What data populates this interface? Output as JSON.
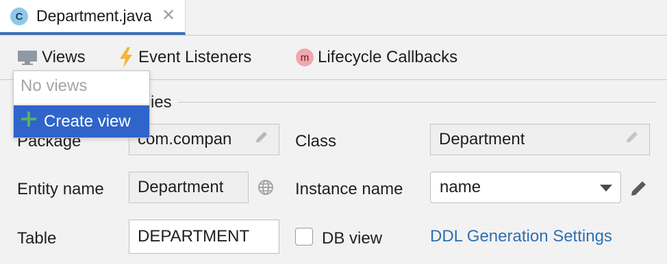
{
  "tab": {
    "icon_letter": "C",
    "title": "Department.java",
    "close_glyph": "✕"
  },
  "toolbar": {
    "views_label": "Views",
    "event_listeners_label": "Event Listeners",
    "lifecycle_icon_letter": "m",
    "lifecycle_callbacks_label": "Lifecycle Callbacks"
  },
  "section": {
    "title_visible_fragment": "ies"
  },
  "views_popup": {
    "empty_text": "No views",
    "create_label": "Create view",
    "create_icon": "+"
  },
  "form": {
    "package_label": "Package",
    "package_value": "com.compan",
    "class_label": "Class",
    "class_value": "Department",
    "entity_name_label": "Entity name",
    "entity_name_value": "Department",
    "instance_name_label": "Instance name",
    "instance_name_value": "name",
    "table_label": "Table",
    "table_value": "DEPARTMENT",
    "db_view_label": "DB view",
    "db_view_checked": false,
    "ddl_link": "DDL Generation Settings"
  },
  "icons": {
    "tab": "class-icon",
    "close": "close-icon",
    "views": "monitor-icon",
    "events": "lightning-icon",
    "lifecycle": "method-icon",
    "pencil": "pencil-icon",
    "globe": "globe-icon",
    "plus": "plus-icon",
    "dropdown": "chevron-down-icon"
  },
  "colors": {
    "accent": "#3c6db9",
    "selection": "#2f65ca",
    "link": "#2f6fb3",
    "lightning": "#f3b43c"
  }
}
